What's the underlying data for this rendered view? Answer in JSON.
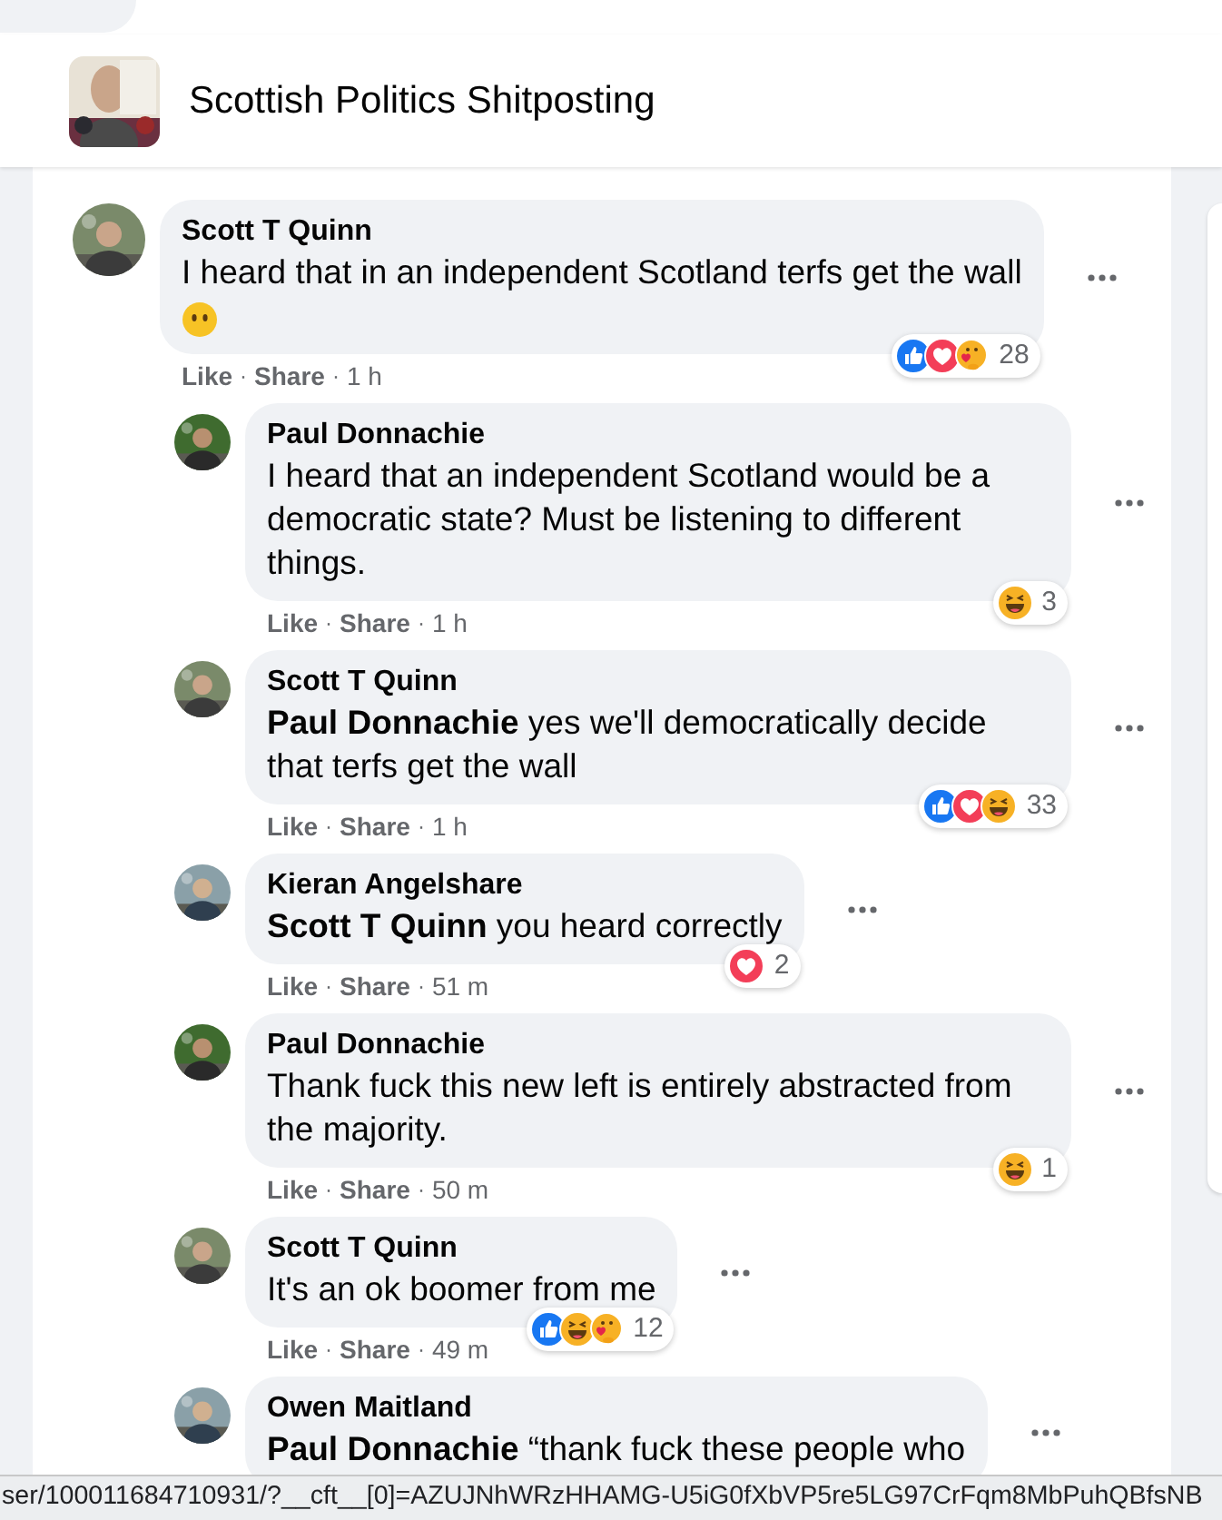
{
  "group": {
    "name": "Scottish Politics Shitposting"
  },
  "separator": "·",
  "comments": [
    {
      "author": "Scott T Quinn",
      "text": "I heard that in an independent Scotland terfs get the wall",
      "trailing_icon": {
        "kind": "blank_face"
      },
      "actions": [
        "Like",
        "Share",
        "1 h"
      ],
      "reactions": {
        "icons": [
          {
            "kind": "like"
          },
          {
            "kind": "love"
          },
          {
            "kind": "care"
          }
        ],
        "count": "28"
      },
      "replies": [
        {
          "author": "Paul Donnachie",
          "text": "I heard that an independent Scotland would be a democratic state? Must be listening to different things.",
          "actions": [
            "Like",
            "Share",
            "1 h"
          ],
          "reactions": {
            "icons": [
              {
                "kind": "haha"
              }
            ],
            "count": "3"
          }
        },
        {
          "author": "Scott T Quinn",
          "text": "**Paul Donnachie** yes we'll democratically decide that terfs get the wall",
          "actions": [
            "Like",
            "Share",
            "1 h"
          ],
          "reactions": {
            "icons": [
              {
                "kind": "like"
              },
              {
                "kind": "love"
              },
              {
                "kind": "haha"
              }
            ],
            "count": "33"
          }
        },
        {
          "author": "Kieran Angelshare",
          "text": "**Scott T Quinn** you heard correctly",
          "actions": [
            "Like",
            "Share",
            "51 m"
          ],
          "reactions": {
            "icons": [
              {
                "kind": "love"
              }
            ],
            "count": "2"
          }
        },
        {
          "author": "Paul Donnachie",
          "text": "Thank fuck this new left is entirely abstracted from the majority.",
          "actions": [
            "Like",
            "Share",
            "50 m"
          ],
          "reactions": {
            "icons": [
              {
                "kind": "haha"
              }
            ],
            "count": "1"
          }
        },
        {
          "author": "Scott T Quinn",
          "text": "It's an ok boomer from me",
          "actions": [
            "Like",
            "Share",
            "49 m"
          ],
          "reactions": {
            "icons": [
              {
                "kind": "like"
              },
              {
                "kind": "haha"
              },
              {
                "kind": "care"
              }
            ],
            "count": "12"
          }
        },
        {
          "author": "Owen Maitland",
          "text": "**Paul Donnachie** “thank fuck these people who"
        }
      ]
    }
  ],
  "status_bar": {
    "url": "ser/100011684710931/?__cft__[0]=AZUJNhWRzHHAMG-U5iG0fXbVP5re5LG97CrFqm8MbPuhQBfsNB"
  }
}
